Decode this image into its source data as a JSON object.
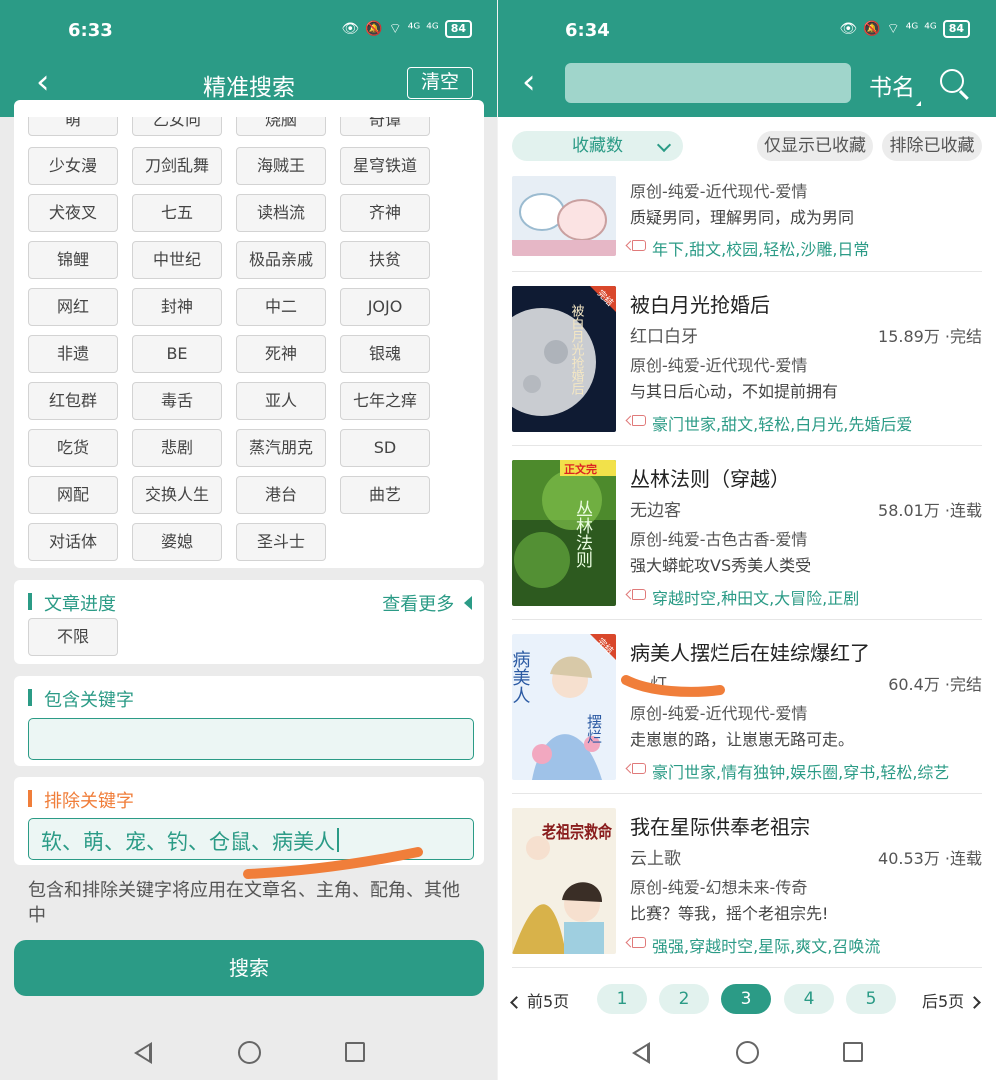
{
  "left": {
    "status_time": "6:33",
    "status_signal_1": "⁴ᴳ",
    "status_signal_2": "⁴ᴳ",
    "battery": "84",
    "title": "精准搜索",
    "clear_label": "清空",
    "tags": [
      {
        "label": "萌"
      },
      {
        "label": "乙女向"
      },
      {
        "label": "烧脑"
      },
      {
        "label": "奇谭"
      },
      {
        "label": "少女漫"
      },
      {
        "label": "刀剑乱舞"
      },
      {
        "label": "海贼王"
      },
      {
        "label": "星穹铁道"
      },
      {
        "label": "犬夜叉"
      },
      {
        "label": "七五"
      },
      {
        "label": "读档流"
      },
      {
        "label": "齐神"
      },
      {
        "label": "锦鲤"
      },
      {
        "label": "中世纪"
      },
      {
        "label": "极品亲戚"
      },
      {
        "label": "扶贫"
      },
      {
        "label": "网红"
      },
      {
        "label": "封神"
      },
      {
        "label": "中二"
      },
      {
        "label": "JOJO"
      },
      {
        "label": "非遗"
      },
      {
        "label": "BE"
      },
      {
        "label": "死神"
      },
      {
        "label": "银魂"
      },
      {
        "label": "红包群"
      },
      {
        "label": "毒舌"
      },
      {
        "label": "亚人"
      },
      {
        "label": "七年之痒"
      },
      {
        "label": "吃货"
      },
      {
        "label": "悲剧"
      },
      {
        "label": "蒸汽朋克"
      },
      {
        "label": "SD"
      },
      {
        "label": "网配"
      },
      {
        "label": "交换人生"
      },
      {
        "label": "港台"
      },
      {
        "label": "曲艺"
      },
      {
        "label": "对话体"
      },
      {
        "label": "婆媳"
      },
      {
        "label": "圣斗士"
      }
    ],
    "progress_title": "文章进度",
    "more_label": "查看更多",
    "progress_value": "不限",
    "include_title": "包含关键字",
    "include_value": "",
    "exclude_title": "排除关键字",
    "exclude_value": "软、萌、宠、钓、仓鼠、病美人",
    "hint": "包含和排除关键字将应用在文章名、主角、配角、其他中",
    "search_label": "搜索"
  },
  "right": {
    "status_time": "6:34",
    "status_signal_1": "⁴ᴳ",
    "status_signal_2": "⁴ᴳ",
    "battery": "84",
    "search_value": "",
    "search_type": "书名",
    "sort_label": "收藏数",
    "only_fav_label": "仅显示已收藏",
    "exclude_fav_label": "排除已收藏",
    "books": [
      {
        "title": "",
        "author": "",
        "count": "",
        "category": "原创-纯爱-近代现代-爱情",
        "desc": "质疑男同，理解男同，成为男同",
        "tags": "年下,甜文,校园,轻松,沙雕,日常"
      },
      {
        "title": "被白月光抢婚后",
        "author": "红口白牙",
        "count": "15.89万 ·完结",
        "category": "原创-纯爱-近代现代-爱情",
        "desc": "与其日后心动，不如提前拥有",
        "tags": "豪门世家,甜文,轻松,白月光,先婚后爱"
      },
      {
        "title": "丛林法则（穿越）",
        "author": "无边客",
        "count": "58.01万 ·连载",
        "category": "原创-纯爱-古色古香-爱情",
        "desc": "强大蟒蛇攻VS秀美人类受",
        "tags": "穿越时空,种田文,大冒险,正剧"
      },
      {
        "title": "病美人摆烂后在娃综爆红了",
        "author": "灯",
        "count": "60.4万 ·完结",
        "category": "原创-纯爱-近代现代-爱情",
        "desc": "走崽崽的路，让崽崽无路可走。",
        "tags": "豪门世家,情有独钟,娱乐圈,穿书,轻松,综艺"
      },
      {
        "title": "我在星际供奉老祖宗",
        "author": "云上歌",
        "count": "40.53万 ·连载",
        "category": "原创-纯爱-幻想未来-传奇",
        "desc": "比赛？等我，摇个老祖宗先!",
        "tags": "强强,穿越时空,星际,爽文,召唤流"
      }
    ],
    "covers": {
      "c2_badge": "完结",
      "c2_text": "被白月光抢婚后",
      "c3_badge": "正文完",
      "c3_text": "丛林法则",
      "c4_badge": "完结",
      "c4_text_a": "病美人",
      "c4_text_b": "摆烂",
      "c5_text": "老祖宗救命"
    },
    "pager": {
      "prev": "前5页",
      "pages": [
        "1",
        "2",
        "3",
        "4",
        "5"
      ],
      "active": "3",
      "next": "后5页"
    }
  },
  "colors": {
    "primary": "#2b9b86",
    "accent_orange": "#f07e3a",
    "tag_icon": "#e07a7a"
  }
}
